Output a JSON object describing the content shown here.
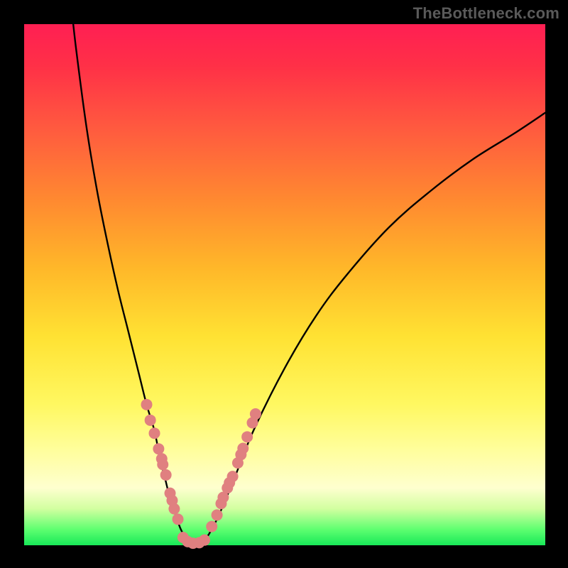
{
  "watermark": "TheBottleneck.com",
  "colors": {
    "background": "#000000",
    "curve": "#000000",
    "dot": "#e08080"
  },
  "chart_data": {
    "type": "line",
    "title": "",
    "xlabel": "",
    "ylabel": "",
    "xlim": [
      0,
      100
    ],
    "ylim": [
      0,
      100
    ],
    "grid": false,
    "curve_left": {
      "x": [
        9,
        10,
        12,
        14,
        16,
        18,
        20,
        22,
        23.5,
        25,
        26,
        27,
        28,
        29,
        30,
        31,
        32
      ],
      "y": [
        104,
        95,
        80,
        68,
        58,
        49,
        41,
        33,
        27,
        22,
        17,
        13,
        9,
        6,
        3.2,
        1.4,
        0.4
      ]
    },
    "curve_right": {
      "x": [
        34,
        35,
        37,
        40,
        44,
        50,
        56,
        62,
        70,
        78,
        86,
        94,
        100
      ],
      "y": [
        0.4,
        1.4,
        5,
        12,
        22,
        34,
        44,
        52,
        61,
        68,
        74,
        79,
        83
      ]
    },
    "flat_bottom": {
      "x": [
        32,
        34
      ],
      "y": [
        0.4,
        0.4
      ]
    },
    "dots_left_branch": {
      "x": [
        23.5,
        24.2,
        25.0,
        25.8,
        26.4,
        26.6,
        27.2,
        28.0,
        28.4,
        28.8,
        29.5
      ],
      "y": [
        27.0,
        24.0,
        21.5,
        18.5,
        16.6,
        15.5,
        13.5,
        10.0,
        8.6,
        7.0,
        5.0
      ]
    },
    "dots_bottom": {
      "x": [
        30.5,
        31.4,
        32.4,
        33.6,
        34.6
      ],
      "y": [
        1.5,
        0.7,
        0.4,
        0.5,
        1.0
      ]
    },
    "dots_right_branch": {
      "x": [
        36.0,
        37.0,
        37.8,
        38.2,
        39.0,
        39.4,
        40.0,
        41.0,
        41.6,
        42.0,
        42.8,
        43.8,
        44.4
      ],
      "y": [
        3.6,
        5.8,
        8.0,
        9.2,
        11.0,
        12.0,
        13.2,
        15.8,
        17.4,
        18.6,
        20.8,
        23.5,
        25.2
      ]
    }
  }
}
